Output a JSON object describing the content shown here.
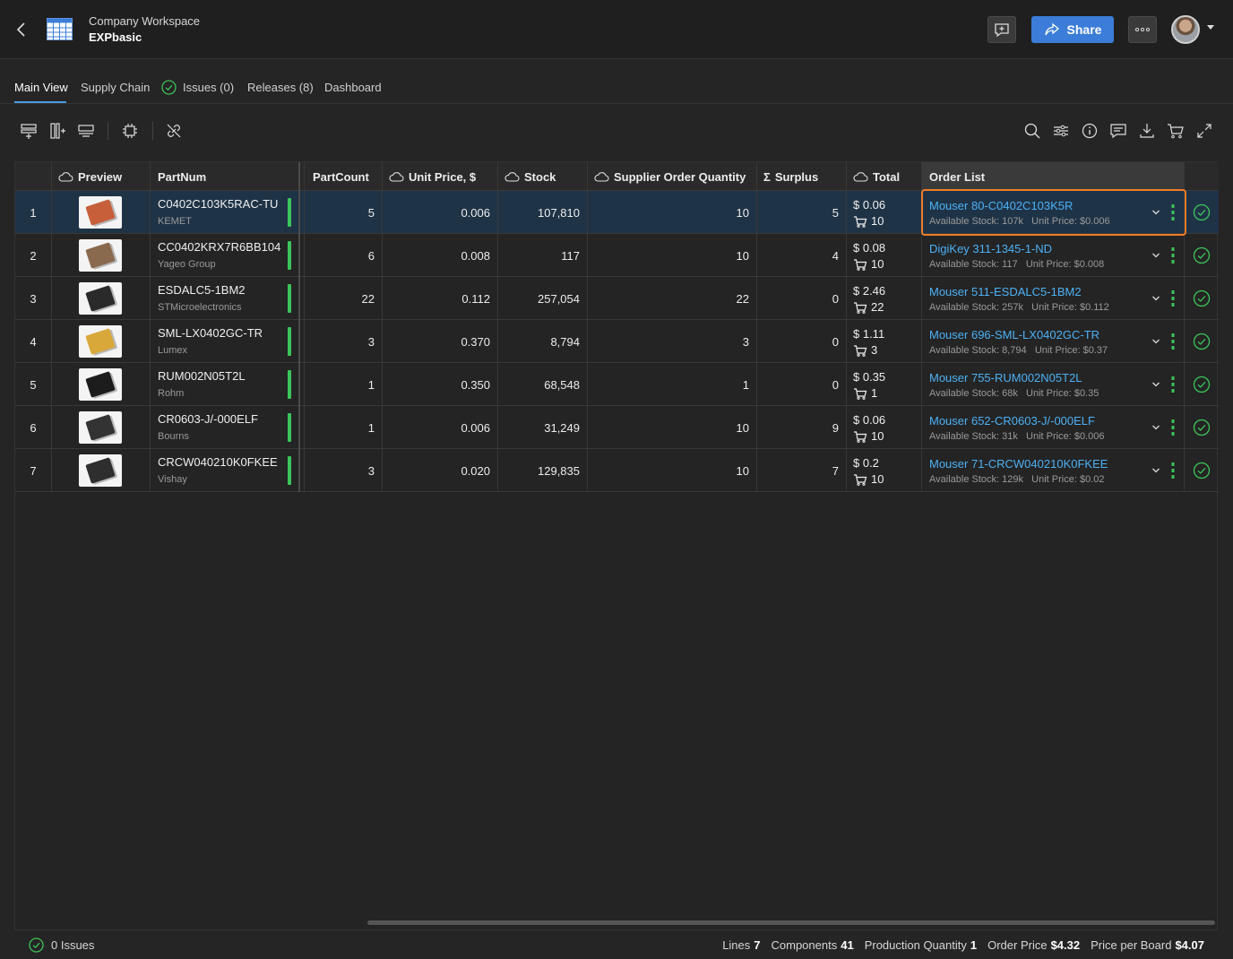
{
  "header": {
    "workspace": "Company Workspace",
    "project": "EXPbasic",
    "share_label": "Share"
  },
  "tabs": [
    {
      "label": "Main View",
      "active": true
    },
    {
      "label": "Supply Chain"
    },
    {
      "label": "Issues (0)",
      "icon": "check-circle-icon"
    },
    {
      "label": "Releases (8)"
    },
    {
      "label": "Dashboard"
    }
  ],
  "toolbar": {
    "left_icons": [
      "add-row-icon",
      "add-column-icon",
      "row-layout-icon",
      "chip-icon",
      "unlink-icon"
    ],
    "right_icons": [
      "search-icon",
      "filter-icon",
      "info-icon",
      "comment-icon",
      "download-icon",
      "cart-icon",
      "expand-icon"
    ]
  },
  "columns": {
    "preview": "Preview",
    "partnum": "PartNum",
    "partcount": "PartCount",
    "unit_price": "Unit Price, $",
    "stock": "Stock",
    "soq": "Supplier Order Quantity",
    "surplus": "Surplus",
    "total": "Total",
    "order_list": "Order List"
  },
  "rows": [
    {
      "n": "1",
      "part": "C0402C103K5RAC-TU",
      "mfr": "KEMET",
      "count": "5",
      "price": "0.006",
      "stock": "107,810",
      "soq": "10",
      "surplus": "5",
      "total": "$ 0.06",
      "cart": "10",
      "ol_link": "Mouser 80-C0402C103K5R",
      "ol_stock": "Available Stock: 107k",
      "ol_price": "Unit Price: $0.006",
      "thumb": "#c7603a"
    },
    {
      "n": "2",
      "part": "CC0402KRX7R6BB104",
      "mfr": "Yageo Group",
      "count": "6",
      "price": "0.008",
      "stock": "117",
      "soq": "10",
      "surplus": "4",
      "total": "$ 0.08",
      "cart": "10",
      "ol_link": "DigiKey 311-1345-1-ND",
      "ol_stock": "Available Stock: 117",
      "ol_price": "Unit Price: $0.008",
      "thumb": "#8a6a4e"
    },
    {
      "n": "3",
      "part": "ESDALC5-1BM2",
      "mfr": "STMicroelectronics",
      "count": "22",
      "price": "0.112",
      "stock": "257,054",
      "soq": "22",
      "surplus": "0",
      "total": "$ 2.46",
      "cart": "22",
      "ol_link": "Mouser 511-ESDALC5-1BM2",
      "ol_stock": "Available Stock: 257k",
      "ol_price": "Unit Price: $0.112",
      "thumb": "#2a2a2a"
    },
    {
      "n": "4",
      "part": "SML-LX0402GC-TR",
      "mfr": "Lumex",
      "count": "3",
      "price": "0.370",
      "stock": "8,794",
      "soq": "3",
      "surplus": "0",
      "total": "$ 1.11",
      "cart": "3",
      "ol_link": "Mouser 696-SML-LX0402GC-TR",
      "ol_stock": "Available Stock: 8,794",
      "ol_price": "Unit Price: $0.37",
      "thumb": "#d9a83a"
    },
    {
      "n": "5",
      "part": "RUM002N05T2L",
      "mfr": "Rohm",
      "count": "1",
      "price": "0.350",
      "stock": "68,548",
      "soq": "1",
      "surplus": "0",
      "total": "$ 0.35",
      "cart": "1",
      "ol_link": "Mouser 755-RUM002N05T2L",
      "ol_stock": "Available Stock: 68k",
      "ol_price": "Unit Price: $0.35",
      "thumb": "#1c1c1c"
    },
    {
      "n": "6",
      "part": "CR0603-J/-000ELF",
      "mfr": "Bourns",
      "count": "1",
      "price": "0.006",
      "stock": "31,249",
      "soq": "10",
      "surplus": "9",
      "total": "$ 0.06",
      "cart": "10",
      "ol_link": "Mouser 652-CR0603-J/-000ELF",
      "ol_stock": "Available Stock: 31k",
      "ol_price": "Unit Price: $0.006",
      "thumb": "#333333"
    },
    {
      "n": "7",
      "part": "CRCW040210K0FKEE",
      "mfr": "Vishay",
      "count": "3",
      "price": "0.020",
      "stock": "129,835",
      "soq": "10",
      "surplus": "7",
      "total": "$ 0.2",
      "cart": "10",
      "ol_link": "Mouser 71-CRCW040210K0FKEE",
      "ol_stock": "Available Stock: 129k",
      "ol_price": "Unit Price: $0.02",
      "thumb": "#2e2e2e"
    }
  ],
  "status": {
    "issues": "0 Issues",
    "lines_label": "Lines",
    "lines": "7",
    "components_label": "Components",
    "components": "41",
    "pq_label": "Production Quantity",
    "pq": "1",
    "order_price_label": "Order Price",
    "order_price": "$4.32",
    "ppb_label": "Price per Board",
    "ppb": "$4.07"
  },
  "colors": {
    "accent": "#3b7dd8",
    "link": "#4db1f5",
    "ok": "#3cc45a",
    "selection": "#ef7d2a"
  }
}
